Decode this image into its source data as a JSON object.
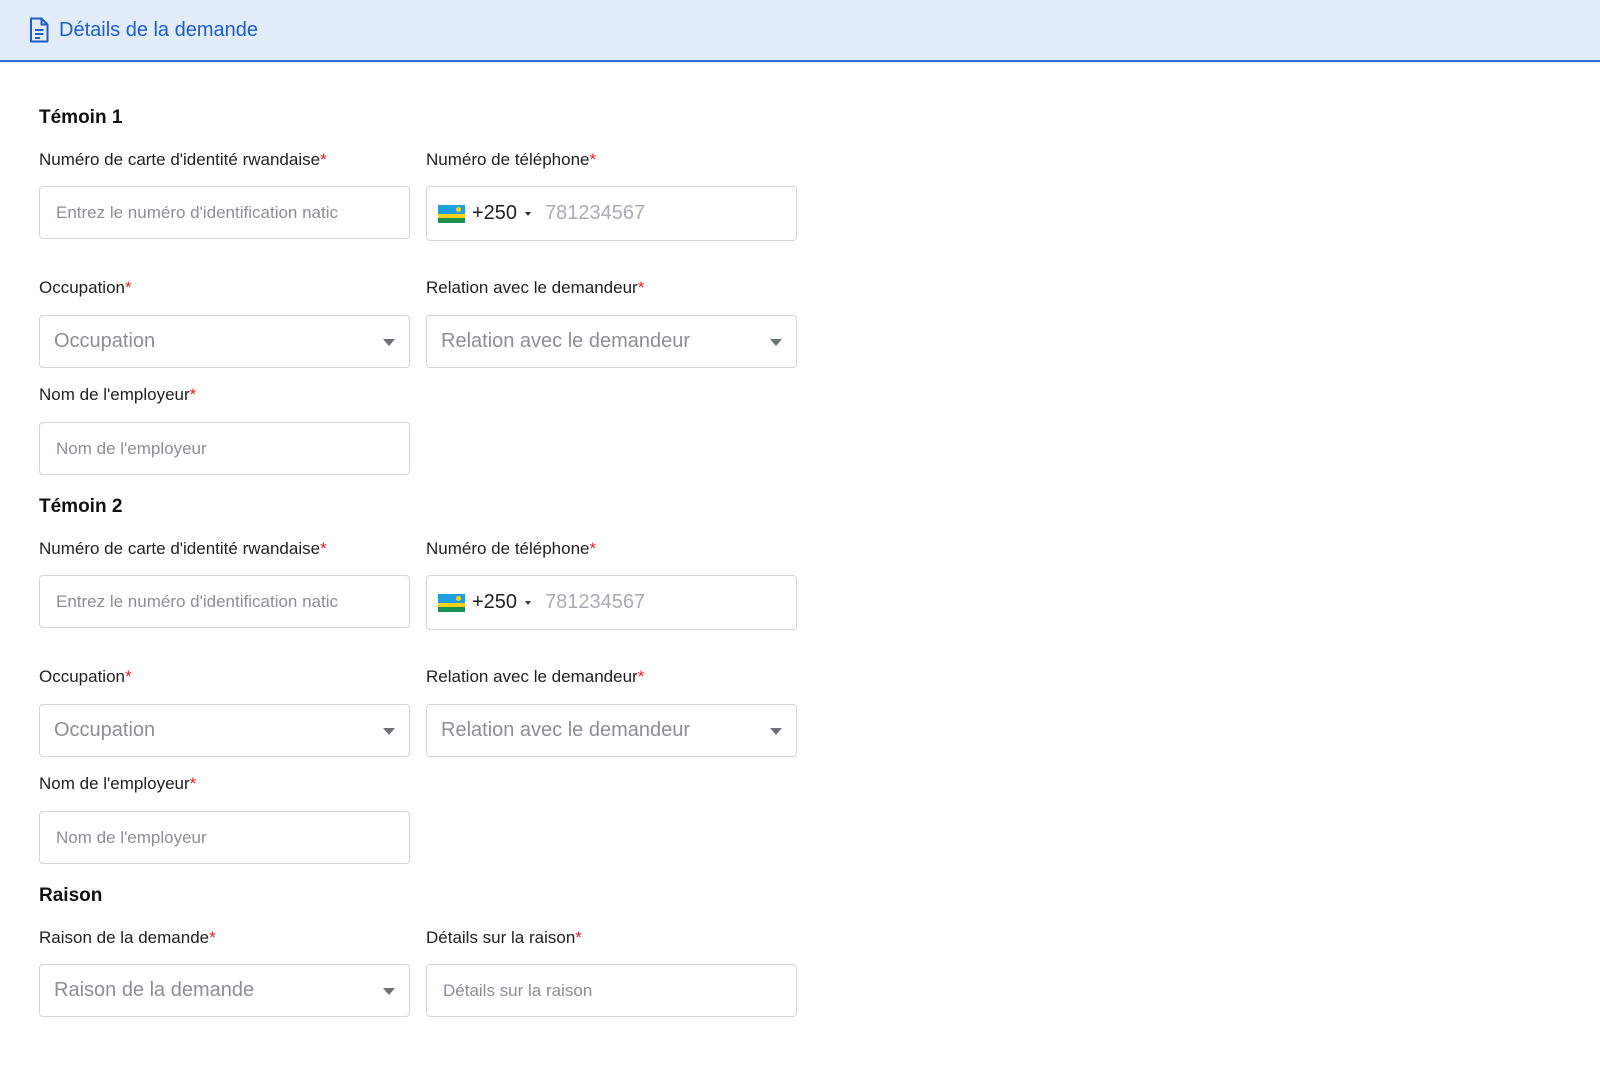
{
  "header": {
    "title": "Détails de la demande",
    "icon": "document-icon"
  },
  "required_mark": "*",
  "witness1": {
    "title": "Témoin 1",
    "id_label": "Numéro de carte d'identité rwandaise",
    "id_placeholder": "Entrez le numéro d'identification natic",
    "phone_label": "Numéro de téléphone",
    "phone_code": "+250",
    "phone_placeholder": "781234567",
    "occupation_label": "Occupation",
    "occupation_placeholder": "Occupation",
    "relation_label": "Relation avec le demandeur",
    "relation_placeholder": "Relation avec le demandeur",
    "employer_label": "Nom de l'employeur",
    "employer_placeholder": "Nom de l'employeur"
  },
  "witness2": {
    "title": "Témoin 2",
    "id_label": "Numéro de carte d'identité rwandaise",
    "id_placeholder": "Entrez le numéro d'identification natic",
    "phone_label": "Numéro de téléphone",
    "phone_code": "+250",
    "phone_placeholder": "781234567",
    "occupation_label": "Occupation",
    "occupation_placeholder": "Occupation",
    "relation_label": "Relation avec le demandeur",
    "relation_placeholder": "Relation avec le demandeur",
    "employer_label": "Nom de l'employeur",
    "employer_placeholder": "Nom de l'employeur"
  },
  "reason": {
    "title": "Raison",
    "reason_label": "Raison de la demande",
    "reason_placeholder": "Raison de la demande",
    "details_label": "Détails sur la raison",
    "details_placeholder": "Détails sur la raison"
  },
  "colors": {
    "accent": "#1d5ec9",
    "header_bg": "#e1ecf8",
    "required": "#e02424"
  }
}
